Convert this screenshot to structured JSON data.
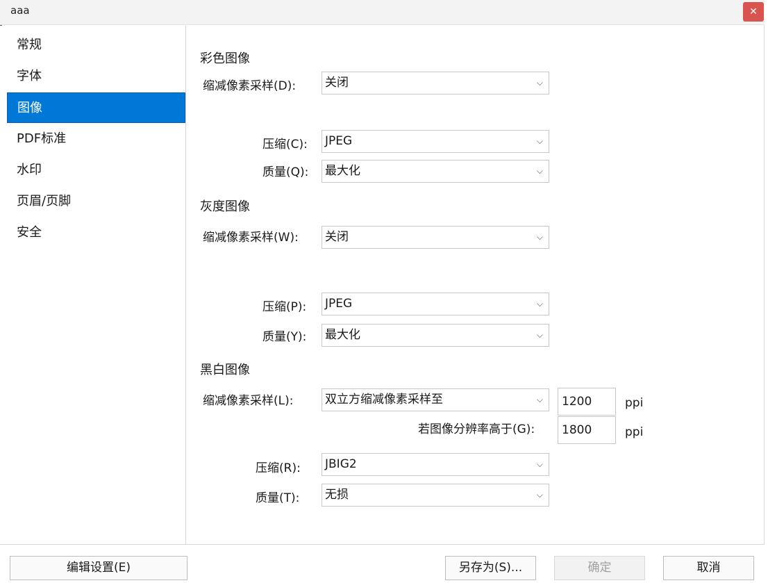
{
  "window": {
    "title": "aaa",
    "close_glyph": "✕"
  },
  "sidebar": {
    "items": [
      {
        "label": "常规"
      },
      {
        "label": "字体"
      },
      {
        "label": "图像"
      },
      {
        "label": "PDF标准"
      },
      {
        "label": "水印"
      },
      {
        "label": "页眉/页脚"
      },
      {
        "label": "安全"
      }
    ],
    "active_index": 2
  },
  "color_image": {
    "title": "彩色图像",
    "downsample_label": "缩减像素采样(D):",
    "downsample_value": "关闭",
    "compress_label": "压缩(C):",
    "compress_value": "JPEG",
    "quality_label": "质量(Q):",
    "quality_value": "最大化"
  },
  "gray_image": {
    "title": "灰度图像",
    "downsample_label": "缩减像素采样(W):",
    "downsample_value": "关闭",
    "compress_label": "压缩(P):",
    "compress_value": "JPEG",
    "quality_label": "质量(Y):",
    "quality_value": "最大化"
  },
  "mono_image": {
    "title": "黑白图像",
    "downsample_label": "缩减像素采样(L):",
    "downsample_value": "双立方缩减像素采样至",
    "resolution_value": "1200",
    "resolution_unit": "ppi",
    "threshold_label": "若图像分辨率高于(G):",
    "threshold_value": "1800",
    "threshold_unit": "ppi",
    "compress_label": "压缩(R):",
    "compress_value": "JBIG2",
    "quality_label": "质量(T):",
    "quality_value": "无损"
  },
  "footer": {
    "edit_settings": "编辑设置(E)",
    "save_as": "另存为(S)...",
    "ok": "确定",
    "cancel": "取消"
  },
  "icons": {
    "chevron": "chevron-down-icon",
    "close": "close-icon"
  },
  "colors": {
    "accent": "#0078d7",
    "close": "#d9534f"
  }
}
